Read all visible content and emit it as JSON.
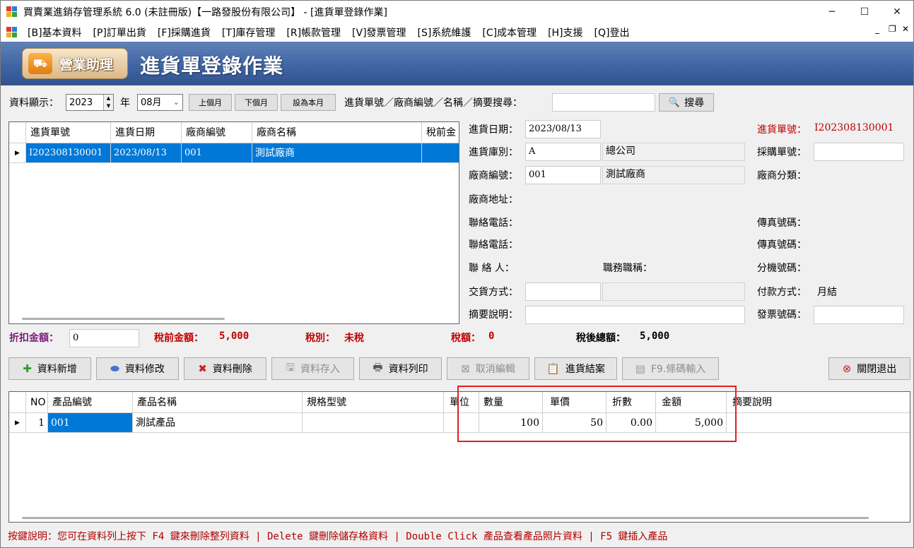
{
  "window": {
    "title": "買賣業進銷存管理系統 6.0 (未註冊版)【一路發股份有限公司】 - [進貨單登錄作業]",
    "minimize": "─",
    "maximize": "☐",
    "close": "✕"
  },
  "menu": {
    "items": [
      "[B]基本資料",
      "[P]訂單出貨",
      "[F]採購進貨",
      "[T]庫存管理",
      "[R]帳款管理",
      "[V]發票管理",
      "[S]系統維護",
      "[C]成本管理",
      "[H]支援",
      "[Q]登出"
    ],
    "mdi_minimize": "_",
    "mdi_restore": "❐",
    "mdi_close": "✕"
  },
  "banner": {
    "badge": "營業助理",
    "title": "進貨單登錄作業"
  },
  "filter": {
    "display_label": "資料顯示：",
    "year": "2023",
    "year_unit": "年",
    "month": "08月",
    "prev_month": "上個月",
    "next_month": "下個月",
    "this_month": "設為本月",
    "search_label": "進貨單號／廠商編號／名稱／摘要搜尋：",
    "search_value": "",
    "search_button": "搜尋"
  },
  "order_list": {
    "columns": [
      "進貨單號",
      "進貨日期",
      "廠商編號",
      "廠商名稱",
      "稅前金"
    ],
    "rows": [
      [
        "I202308130001",
        "2023/08/13",
        "001",
        "測試廠商",
        ""
      ]
    ]
  },
  "form": {
    "date_label": "進貨日期：",
    "date_value": "2023/08/13",
    "order_no_label": "進貨單號：",
    "order_no_value": "I202308130001",
    "warehouse_label": "進貨庫別：",
    "warehouse_code": "A",
    "warehouse_name": "總公司",
    "purchase_no_label": "採購單號：",
    "purchase_no_value": "",
    "vendor_code_label": "廠商編號：",
    "vendor_code_value": "001",
    "vendor_name_value": "測試廠商",
    "vendor_category_label": "廠商分類：",
    "vendor_address_label": "廠商地址：",
    "phone1_label": "聯絡電話：",
    "fax1_label": "傳真號碼：",
    "phone2_label": "聯絡電話：",
    "fax2_label": "傳真號碼：",
    "contact_label": "聯 絡 人：",
    "title_label": "職務職稱：",
    "ext_label": "分機號碼：",
    "delivery_label": "交貨方式：",
    "delivery_value": "",
    "payment_label": "付款方式：",
    "payment_value": "月結",
    "memo_label": "摘要說明：",
    "memo_value": "",
    "invoice_label": "發票號碼：",
    "invoice_value": ""
  },
  "summary": {
    "discount_label": "折扣金額：",
    "discount_value": "0",
    "pretax_label": "稅前金額：",
    "pretax_value": "5,000",
    "taxtype_label": "稅別：",
    "taxtype_value": "未稅",
    "tax_label": "稅額：",
    "tax_value": "0",
    "total_label": "稅後總額：",
    "total_value": "5,000"
  },
  "toolbar": {
    "add": "資料新增",
    "edit": "資料修改",
    "delete": "資料刪除",
    "save": "資料存入",
    "print": "資料列印",
    "cancel": "取消編輯",
    "close_order": "進貨結案",
    "barcode": "F9.條碼輸入",
    "exit": "關閉退出"
  },
  "detail": {
    "columns": [
      "NO",
      "產品編號",
      "產品名稱",
      "規格型號",
      "單位",
      "數量",
      "單價",
      "折數",
      "金額",
      "摘要說明"
    ],
    "rows": [
      {
        "no": "1",
        "code": "001",
        "name": "測試產品",
        "spec": "",
        "unit": "",
        "qty": "100",
        "price": "50",
        "discount": "0.00",
        "amount": "5,000",
        "memo": ""
      }
    ]
  },
  "status_text": "按鍵說明：您可在資料列上按下 F4 鍵來刪除整列資料 | Delete 鍵刪除儲存格資料 | Double Click 產品查看產品照片資料 | F5 鍵插入產品"
}
